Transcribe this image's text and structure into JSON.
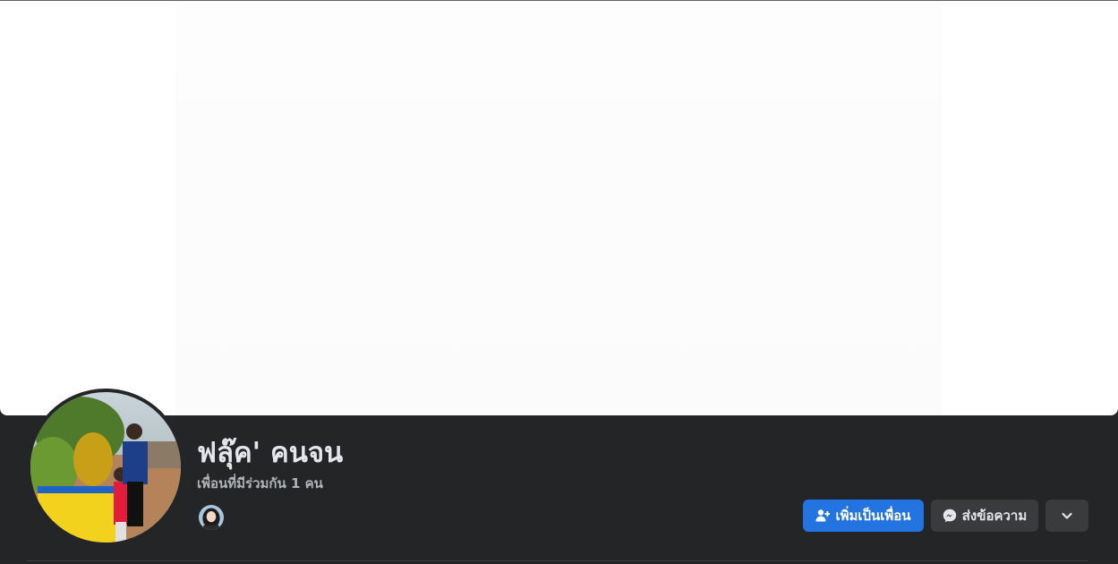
{
  "profile": {
    "name": "ฟลุ๊ค' คนจน",
    "mutual_friends": "เพื่อนที่มีร่วมกัน 1 คน"
  },
  "actions": {
    "add_friend_label": "เพิ่มเป็นเพื่อน",
    "message_label": "ส่งข้อความ"
  },
  "icons": {
    "add_friend": "add-friend-icon",
    "messenger": "messenger-icon",
    "more": "chevron-down-icon"
  },
  "colors": {
    "background": "#242526",
    "primary_button": "#2374e1",
    "secondary_button": "#3a3b3c",
    "name_text": "#e4e6eb",
    "secondary_text": "#b0b3b8"
  }
}
